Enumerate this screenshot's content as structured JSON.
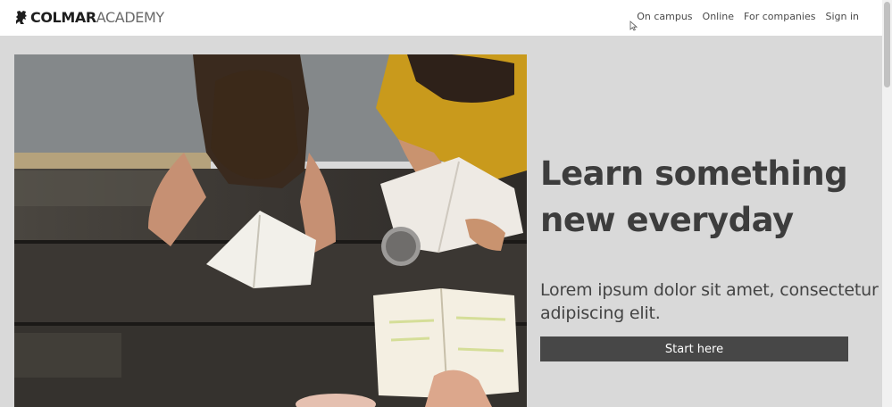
{
  "logo": {
    "strong": "COLMAR",
    "light": "ACADEMY"
  },
  "nav": {
    "items": [
      {
        "label": "On campus"
      },
      {
        "label": "Online"
      },
      {
        "label": "For companies"
      },
      {
        "label": "Sign in"
      }
    ]
  },
  "hero": {
    "headline": "Learn something new everyday",
    "subtext": "Lorem ipsum dolor sit amet, consectetur adipiscing elit.",
    "cta_label": "Start here"
  }
}
